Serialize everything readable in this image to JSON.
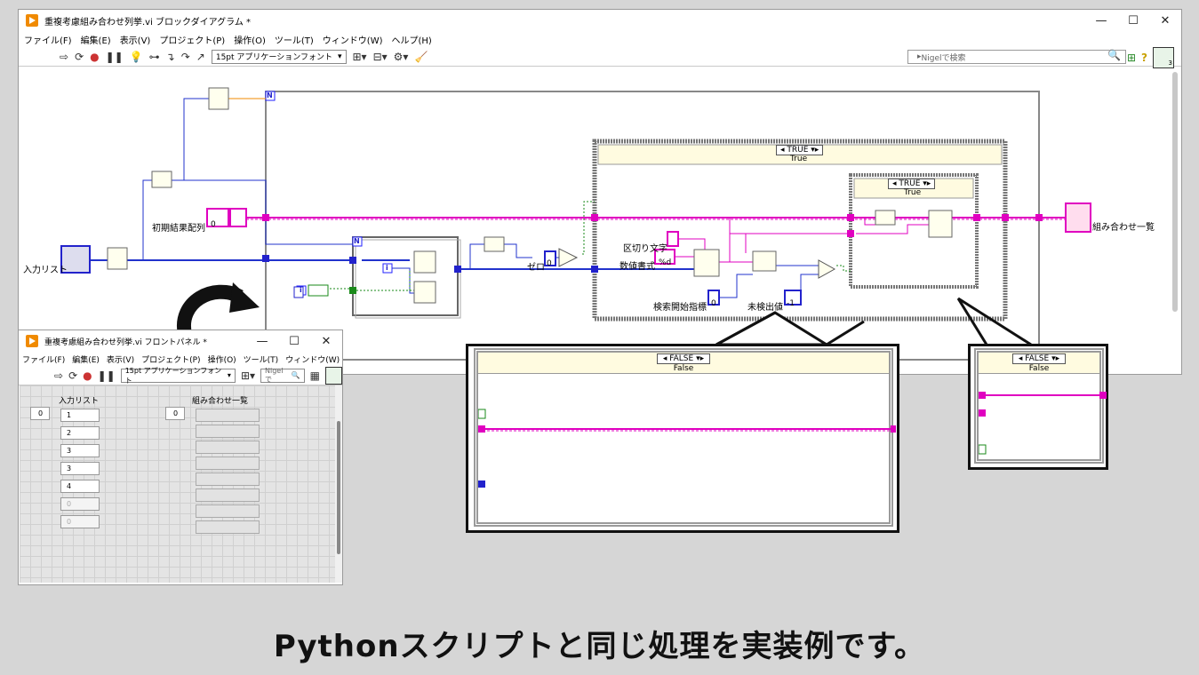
{
  "main_window": {
    "title": "重複考慮組み合わせ列挙.vi ブロックダイアグラム *",
    "menu": [
      "ファイル(F)",
      "編集(E)",
      "表示(V)",
      "プロジェクト(P)",
      "操作(O)",
      "ツール(T)",
      "ウィンドウ(W)",
      "ヘルプ(H)"
    ],
    "font_select": "15pt アプリケーションフォント",
    "search_placeholder": "Nigelで検索",
    "vi_icon_count": "3"
  },
  "diagram": {
    "labels": {
      "input_list": "入力リスト",
      "initial_array": "初期結果配列",
      "initial_value": "0",
      "zero": "ゼロ",
      "zero_value": "0",
      "delimiter": "区切り文字",
      "format": "数値書式",
      "format_value": "%d",
      "search_start": "検索開始指標",
      "search_start_value": "0",
      "not_found": "未検出値",
      "not_found_value": "-1",
      "output": "組み合わせ一覧",
      "loop_n": "N",
      "loop_i": "i",
      "outer_case_selector": "TRUE",
      "outer_case_label": "True",
      "inner_case_selector": "TRUE",
      "inner_case_label": "True"
    }
  },
  "callouts": {
    "outer_false_selector": "FALSE",
    "outer_false_label": "False",
    "inner_false_selector": "FALSE",
    "inner_false_label": "False"
  },
  "front_panel": {
    "title": "重複考慮組み合わせ列挙.vi フロントパネル *",
    "menu": [
      "ファイル(F)",
      "編集(E)",
      "表示(V)",
      "プロジェクト(P)",
      "操作(O)",
      "ツール(T)",
      "ウィンドウ(W)"
    ],
    "font_select": "15pt アプリケーションフォント",
    "search_placeholder": "Nigelで",
    "input_label": "入力リスト",
    "output_label": "組み合わせ一覧",
    "input_index": "0",
    "output_index": "0",
    "input_values": [
      "1",
      "2",
      "3",
      "3",
      "4",
      "0",
      "0"
    ]
  },
  "caption": "Pythonスクリプトと同じ処理を実装例です。"
}
